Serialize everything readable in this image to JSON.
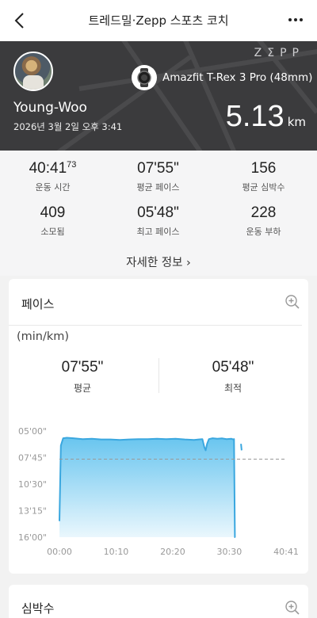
{
  "topbar": {
    "title": "트레드밀·Zepp 스포츠 코치",
    "back_icon": "chevron-left-icon",
    "more_icon": "more-horizontal-icon"
  },
  "hero": {
    "brand": "ZΣPP",
    "device": "Amazfit T-Rex 3 Pro (48mm)",
    "user_name": "Young-Woo",
    "date": "2026년 3월 2일 오후 3:41",
    "distance": "5.13",
    "distance_unit": "km"
  },
  "stats": [
    {
      "value": "40:41",
      "sup": "73",
      "label": "운동 시간"
    },
    {
      "value": "07'55\"",
      "sup": "",
      "label": "평균 페이스"
    },
    {
      "value": "156",
      "sup": "",
      "label": "평균 심박수"
    },
    {
      "value": "409",
      "sup": "",
      "label": "소모됨"
    },
    {
      "value": "05'48\"",
      "sup": "",
      "label": "최고 페이스"
    },
    {
      "value": "228",
      "sup": "",
      "label": "운동 부하"
    }
  ],
  "more_details": "자세한 정보 ›",
  "pace_card": {
    "title": "페이스",
    "unit": "(min/km)",
    "avg_value": "07'55\"",
    "avg_label": "평균",
    "best_value": "05'48\"",
    "best_label": "최적"
  },
  "hr_card": {
    "title": "심박수"
  },
  "chart_data": {
    "type": "area",
    "title": "",
    "xlabel": "",
    "ylabel": "(min/km)",
    "y_inverted": true,
    "y_ticks": [
      "05'00\"",
      "07'45\"",
      "10'30\"",
      "13'15\"",
      "16'00\""
    ],
    "y_tick_seconds": [
      300,
      465,
      630,
      795,
      960
    ],
    "x_ticks": [
      "00:00",
      "10:10",
      "20:20",
      "30:30",
      "40:41"
    ],
    "x_tick_seconds": [
      0,
      610,
      1220,
      1830,
      2441
    ],
    "average_line_seconds": 475,
    "grid": false,
    "colors": {
      "line": "#3aa7df",
      "fill_top": "#69c5ef",
      "fill_bottom": "#eaf7fd",
      "avg_line": "#999999"
    },
    "series": [
      {
        "x_seconds": [
          0,
          15,
          40,
          80,
          150,
          250,
          350,
          450,
          550,
          650,
          750,
          850,
          950,
          1050,
          1150,
          1250,
          1350,
          1450,
          1500,
          1540,
          1560,
          1575,
          1590,
          1610,
          1650,
          1700,
          1750,
          1800,
          1850,
          1870,
          1880,
          1890,
          1895
        ],
        "y_seconds": [
          860,
          390,
          345,
          342,
          345,
          350,
          348,
          352,
          352,
          355,
          352,
          350,
          350,
          348,
          350,
          348,
          352,
          355,
          352,
          350,
          400,
          420,
          380,
          350,
          345,
          348,
          346,
          350,
          348,
          352,
          350,
          960,
          960
        ]
      },
      {
        "x_seconds": [
          1955,
          1962
        ],
        "y_seconds": [
          380,
          420
        ]
      }
    ]
  }
}
